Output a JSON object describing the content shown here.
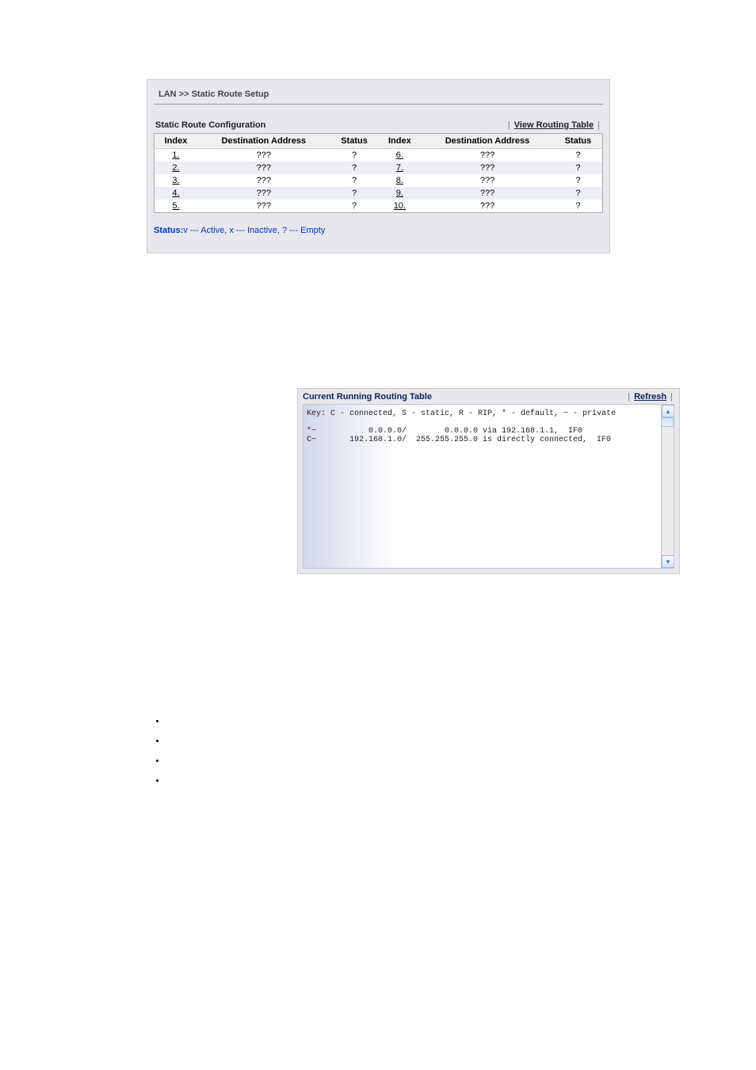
{
  "panel1": {
    "breadcrumb": "LAN >> Static Route Setup",
    "title": "Static Route Configuration",
    "view_link_label": "View Routing Table",
    "headers": [
      "Index",
      "Destination Address",
      "Status",
      "Index",
      "Destination Address",
      "Status"
    ],
    "rows": [
      {
        "left": {
          "index": "1.",
          "dest": "???",
          "status": "?"
        },
        "right": {
          "index": "6.",
          "dest": "???",
          "status": "?"
        }
      },
      {
        "left": {
          "index": "2.",
          "dest": "???",
          "status": "?"
        },
        "right": {
          "index": "7.",
          "dest": "???",
          "status": "?"
        }
      },
      {
        "left": {
          "index": "3.",
          "dest": "???",
          "status": "?"
        },
        "right": {
          "index": "8.",
          "dest": "???",
          "status": "?"
        }
      },
      {
        "left": {
          "index": "4.",
          "dest": "???",
          "status": "?"
        },
        "right": {
          "index": "9.",
          "dest": "???",
          "status": "?"
        }
      },
      {
        "left": {
          "index": "5.",
          "dest": "???",
          "status": "?"
        },
        "right": {
          "index": "10.",
          "dest": "???",
          "status": "?"
        }
      }
    ],
    "status_hint_label": "Status:",
    "status_hint_text": "v --- Active, x --- Inactive, ? --- Empty"
  },
  "panel2": {
    "title": "Current Running Routing Table",
    "refresh_label": "Refresh",
    "content": "Key: C - connected, S - static, R - RIP, * - default, ~ - private\n\n*~           0.0.0.0/        0.0.0.0 via 192.168.1.1,  IF0\nC~       192.168.1.0/  255.255.255.0 is directly connected,  IF0"
  },
  "bullets": {
    "items": [
      " ",
      " ",
      " ",
      " "
    ]
  }
}
